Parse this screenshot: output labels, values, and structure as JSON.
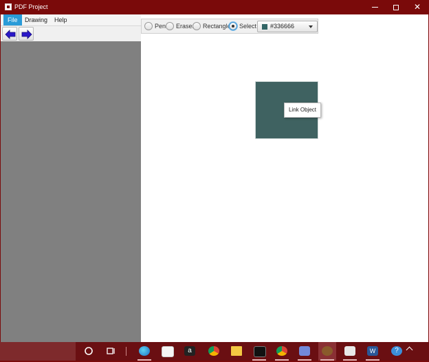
{
  "window": {
    "title": "PDF Project"
  },
  "menu": [
    "File",
    "Drawing",
    "Help"
  ],
  "tools": {
    "options": [
      "Pen",
      "Eraser",
      "Rectangle",
      "Select"
    ],
    "selected": "Select"
  },
  "color_picker": {
    "value": "#336666",
    "swatch": "#336666"
  },
  "canvas": {
    "rect_color": "#3f6261",
    "tooltip": "Link Object"
  },
  "colors": {
    "title_bar": "#7a0a0a",
    "menu_active": "#2a9bd8",
    "left_pane": "#808080",
    "arrow": "#2b18c9"
  },
  "taskbar": {
    "icons": [
      "search-circle-icon",
      "task-view-icon",
      "edge-icon",
      "store-icon",
      "amazon-icon",
      "chrome-icon",
      "file-explorer-icon",
      "terminal-icon",
      "chrome-alt-icon",
      "discord-icon",
      "game-icon",
      "java-icon",
      "word-icon",
      "help-icon"
    ]
  }
}
